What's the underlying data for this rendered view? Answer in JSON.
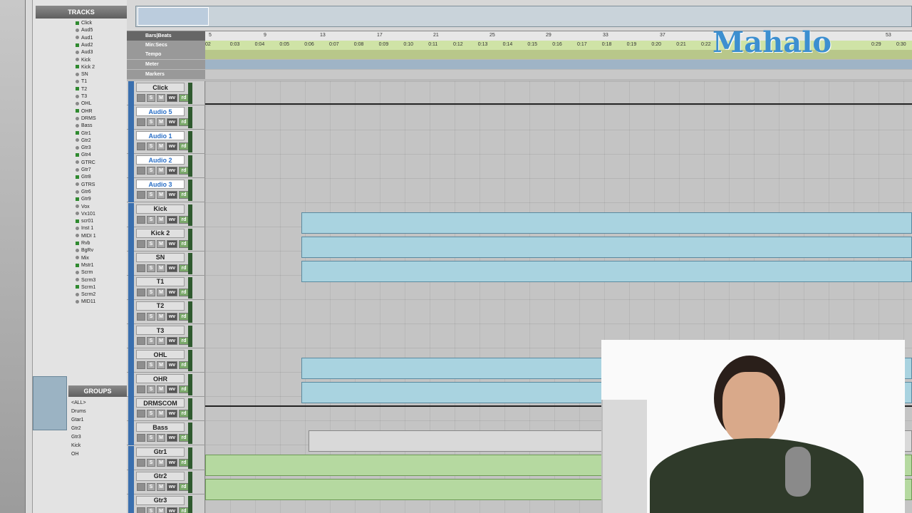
{
  "left_panel": {
    "tracks_title": "TRACKS",
    "groups_title": "GROUPS",
    "track_list": [
      "Click",
      "Aud5",
      "Aud1",
      "Aud2",
      "Aud3",
      "Kick",
      "Kick 2",
      "SN",
      "T1",
      "T2",
      "T3",
      "OHL",
      "OHR",
      "DRMS",
      "Bass",
      "Gtr1",
      "Gtr2",
      "Gtr3",
      "Gtr4",
      "GTRC",
      "Gtr7",
      "Gtr8",
      "GTRS",
      "Gtr6",
      "Gtr9",
      "Vox",
      "Vx101",
      "scr01",
      "Inst 1",
      "MIDI 1",
      "Rvb",
      "BgRv",
      "Mix",
      "Mstr1",
      "Scrm",
      "Scrm3",
      "Scrm1",
      "Scrm2",
      "MID11"
    ],
    "groups": [
      "<ALL>",
      "Drums",
      "Gtar1",
      "Gtr2",
      "Gtr3",
      "Kick",
      "OH"
    ]
  },
  "rulers": {
    "bars_label": "Bars|Beats",
    "minsecs_label": "Min:Secs",
    "tempo_label": "Tempo",
    "meter_label": "Meter",
    "markers_label": "Markers",
    "bars_ticks": [
      "5",
      "9",
      "13",
      "17",
      "21",
      "25",
      "29",
      "33",
      "37",
      "53"
    ],
    "secs_ticks": [
      "02",
      "0:03",
      "0:04",
      "0:05",
      "0:06",
      "0:07",
      "0:08",
      "0:09",
      "0:10",
      "0:11",
      "0:12",
      "0:13",
      "0:14",
      "0:15",
      "0:16",
      "0:17",
      "0:18",
      "0:19",
      "0:20",
      "0:21",
      "0:22",
      "0:29",
      "0:30"
    ]
  },
  "tracks": [
    {
      "name": "Click",
      "selected": false
    },
    {
      "name": "Audio 5",
      "selected": true
    },
    {
      "name": "Audio 1",
      "selected": true
    },
    {
      "name": "Audio 2",
      "selected": true
    },
    {
      "name": "Audio 3",
      "selected": true
    },
    {
      "name": "Kick",
      "selected": false
    },
    {
      "name": "Kick 2",
      "selected": false
    },
    {
      "name": "SN",
      "selected": false
    },
    {
      "name": "T1",
      "selected": false
    },
    {
      "name": "T2",
      "selected": false
    },
    {
      "name": "T3",
      "selected": false
    },
    {
      "name": "OHL",
      "selected": false
    },
    {
      "name": "OHR",
      "selected": false
    },
    {
      "name": "DRMSCOM",
      "selected": false
    },
    {
      "name": "Bass",
      "selected": false
    },
    {
      "name": "Gtr1",
      "selected": false
    },
    {
      "name": "Gtr2",
      "selected": false
    },
    {
      "name": "Gtr3",
      "selected": false
    }
  ],
  "buttons": {
    "solo": "S",
    "mute": "M",
    "waveform": "wv",
    "read": "rd",
    "click_el": "el"
  },
  "brand": {
    "logo_text": "Mahalo",
    "accent": "#3c8fd0"
  }
}
